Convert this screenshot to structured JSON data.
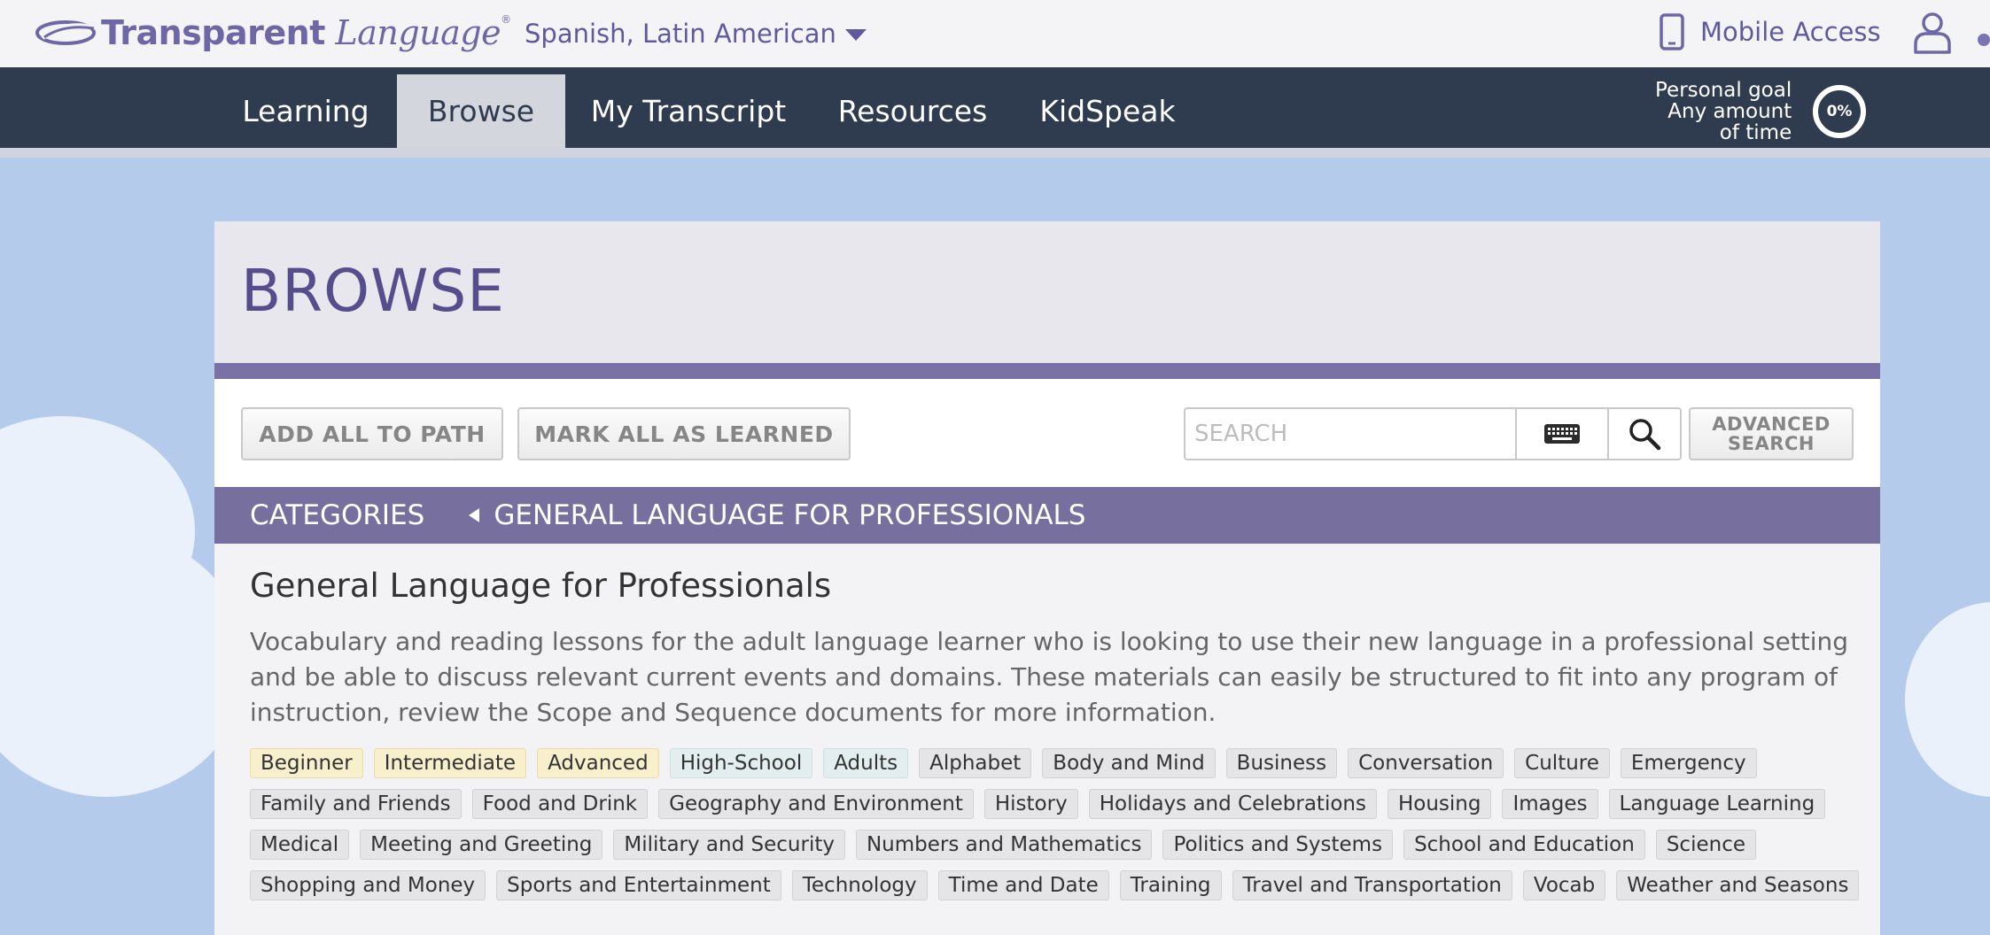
{
  "header": {
    "logo": {
      "brand_bold": "Transparent",
      "brand_italic": "Language",
      "mark": "®"
    },
    "language_selector": "Spanish, Latin American",
    "mobile_access": "Mobile Access"
  },
  "nav": {
    "tabs": [
      {
        "label": "Learning",
        "active": false
      },
      {
        "label": "Browse",
        "active": true
      },
      {
        "label": "My Transcript",
        "active": false
      },
      {
        "label": "Resources",
        "active": false
      },
      {
        "label": "KidSpeak",
        "active": false
      }
    ],
    "goal": {
      "line1": "Personal goal",
      "line2": "Any amount",
      "line3": "of time",
      "percent": "0%"
    }
  },
  "page": {
    "title": "BROWSE",
    "toolbar": {
      "add_all": "ADD ALL TO PATH",
      "mark_all": "MARK ALL AS LEARNED",
      "search_placeholder": "SEARCH",
      "advanced_line1": "ADVANCED",
      "advanced_line2": "SEARCH"
    },
    "breadcrumb": {
      "root": "CATEGORIES",
      "current": "GENERAL LANGUAGE FOR PROFESSIONALS"
    },
    "category": {
      "title": "General Language for Professionals",
      "description": "Vocabulary and reading lessons for the adult language learner who is looking to use their new language in a professional setting and be able to discuss relevant current events and domains. These materials can easily be structured to fit into any program of instruction, review the Scope and Sequence documents for more information.",
      "tags": [
        {
          "label": "Beginner",
          "kind": "level"
        },
        {
          "label": "Intermediate",
          "kind": "level"
        },
        {
          "label": "Advanced",
          "kind": "level"
        },
        {
          "label": "High-School",
          "kind": "audience"
        },
        {
          "label": "Adults",
          "kind": "audience"
        },
        {
          "label": "Alphabet",
          "kind": "topic"
        },
        {
          "label": "Body and Mind",
          "kind": "topic"
        },
        {
          "label": "Business",
          "kind": "topic"
        },
        {
          "label": "Conversation",
          "kind": "topic"
        },
        {
          "label": "Culture",
          "kind": "topic"
        },
        {
          "label": "Emergency",
          "kind": "topic"
        },
        {
          "label": "Family and Friends",
          "kind": "topic"
        },
        {
          "label": "Food and Drink",
          "kind": "topic"
        },
        {
          "label": "Geography and Environment",
          "kind": "topic"
        },
        {
          "label": "History",
          "kind": "topic"
        },
        {
          "label": "Holidays and Celebrations",
          "kind": "topic"
        },
        {
          "label": "Housing",
          "kind": "topic"
        },
        {
          "label": "Images",
          "kind": "topic"
        },
        {
          "label": "Language Learning",
          "kind": "topic"
        },
        {
          "label": "Medical",
          "kind": "topic"
        },
        {
          "label": "Meeting and Greeting",
          "kind": "topic"
        },
        {
          "label": "Military and Security",
          "kind": "topic"
        },
        {
          "label": "Numbers and Mathematics",
          "kind": "topic"
        },
        {
          "label": "Politics and Systems",
          "kind": "topic"
        },
        {
          "label": "School and Education",
          "kind": "topic"
        },
        {
          "label": "Science",
          "kind": "topic"
        },
        {
          "label": "Shopping and Money",
          "kind": "topic"
        },
        {
          "label": "Sports and Entertainment",
          "kind": "topic"
        },
        {
          "label": "Technology",
          "kind": "topic"
        },
        {
          "label": "Time and Date",
          "kind": "topic"
        },
        {
          "label": "Training",
          "kind": "topic"
        },
        {
          "label": "Travel and Transportation",
          "kind": "topic"
        },
        {
          "label": "Vocab",
          "kind": "topic"
        },
        {
          "label": "Weather and Seasons",
          "kind": "topic"
        }
      ]
    }
  },
  "icons": {
    "phone": "phone-icon",
    "user": "user-icon",
    "keyboard": "keyboard-icon",
    "search": "search-icon",
    "caret": "caret-down-icon",
    "back": "caret-left-icon"
  },
  "colors": {
    "brand_purple": "#6e67a6",
    "nav_dark": "#2f3b4f",
    "crumb_purple": "#77709e",
    "sky": "#b4cbec",
    "level_tag": "#f8f0cd",
    "audience_tag": "#e3eef0",
    "topic_tag": "#e5e5e7"
  }
}
